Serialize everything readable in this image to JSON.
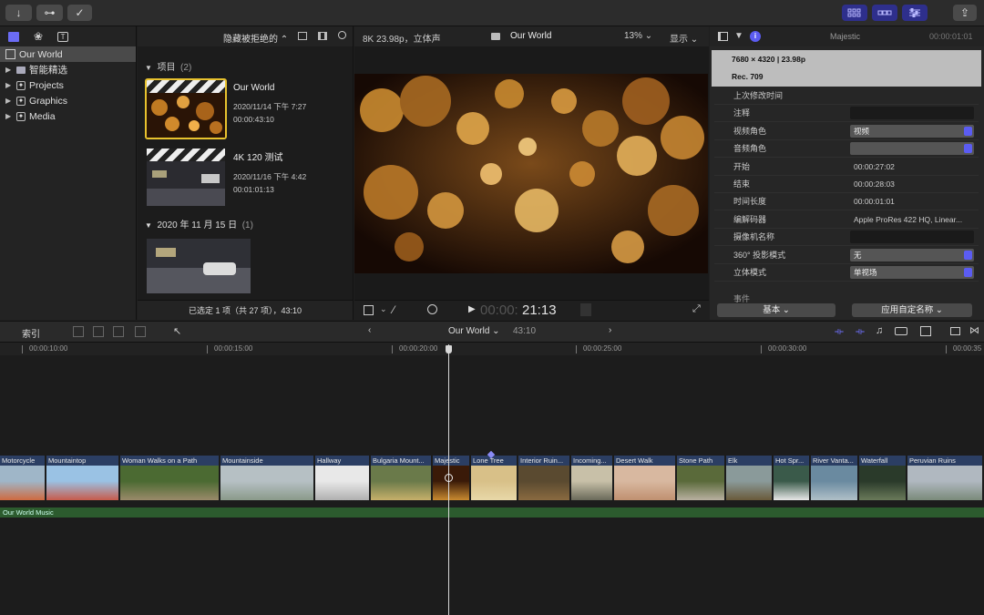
{
  "toolbar": {
    "import_icon": "↓",
    "keyword_icon": "⊶",
    "check_icon": "✓",
    "share_icon": "⇪"
  },
  "libraries": {
    "items": [
      {
        "label": "Our World"
      },
      {
        "label": "智能精选"
      },
      {
        "label": "Projects"
      },
      {
        "label": "Graphics"
      },
      {
        "label": "Media"
      }
    ]
  },
  "browser": {
    "filter_label": "隐藏被拒绝的",
    "section1": {
      "title": "项目",
      "count": "(2)"
    },
    "clips": [
      {
        "title": "Our World",
        "date": "2020/11/14 下午 7:27",
        "duration": "00:00:43:10"
      },
      {
        "title": "4K 120 测试",
        "date": "2020/11/16 下午 4:42",
        "duration": "00:01:01:13"
      }
    ],
    "section2": {
      "title": "2020 年 11 月 15 日",
      "count": "(1)"
    },
    "footer": "已选定 1 项（共 27 项），43:10"
  },
  "viewer": {
    "format": "8K 23.98p，立体声",
    "title": "Our World",
    "zoom": "13%",
    "display_label": "显示",
    "timecode_dim": "00:00:",
    "timecode": "21:13"
  },
  "inspector": {
    "clip_name": "Majestic",
    "clip_time": "00:00:01:01",
    "resolution": "7680 × 4320 | 23.98p",
    "colorspace": "Rec. 709",
    "rows": [
      {
        "label": "上次修改时间",
        "value": ""
      },
      {
        "label": "注释",
        "value": ""
      },
      {
        "label": "视频角色",
        "value": "视频"
      },
      {
        "label": "音频角色",
        "value": ""
      },
      {
        "label": "开始",
        "value": "00:00:27:02"
      },
      {
        "label": "结束",
        "value": "00:00:28:03"
      },
      {
        "label": "时间长度",
        "value": "00:00:01:01"
      },
      {
        "label": "编解码器",
        "value": "Apple ProRes 422 HQ, Linear..."
      },
      {
        "label": "摄像机名称",
        "value": ""
      },
      {
        "label": "360° 投影模式",
        "value": "无"
      },
      {
        "label": "立体模式",
        "value": "单视场"
      }
    ],
    "bottom_section": "事件",
    "basic_button": "基本",
    "apply_button": "应用自定名称"
  },
  "timeline": {
    "index_label": "索引",
    "project_name": "Our World",
    "project_duration": "43:10",
    "ruler": [
      "00:00:10:00",
      "00:00:15:00",
      "00:00:20:00",
      "00:00:25:00",
      "00:00:30:00",
      "00:00:35"
    ],
    "clips": [
      "Motorcycle",
      "Mountaintop",
      "Woman Walks on a Path",
      "Mountainside",
      "Hallway",
      "Bulgaria Mount...",
      "Majestic",
      "Lone Tree",
      "Interior Ruin...",
      "Incoming...",
      "Desert Walk",
      "Stone Path",
      "Elk",
      "Hot Spr...",
      "River Vanta...",
      "Waterfall",
      "Peruvian Ruins"
    ],
    "music_label": "Our World Music"
  },
  "colors": {
    "accent": "#5b5cf2",
    "clip": "#2b3e63",
    "music": "#2c5b2e"
  }
}
